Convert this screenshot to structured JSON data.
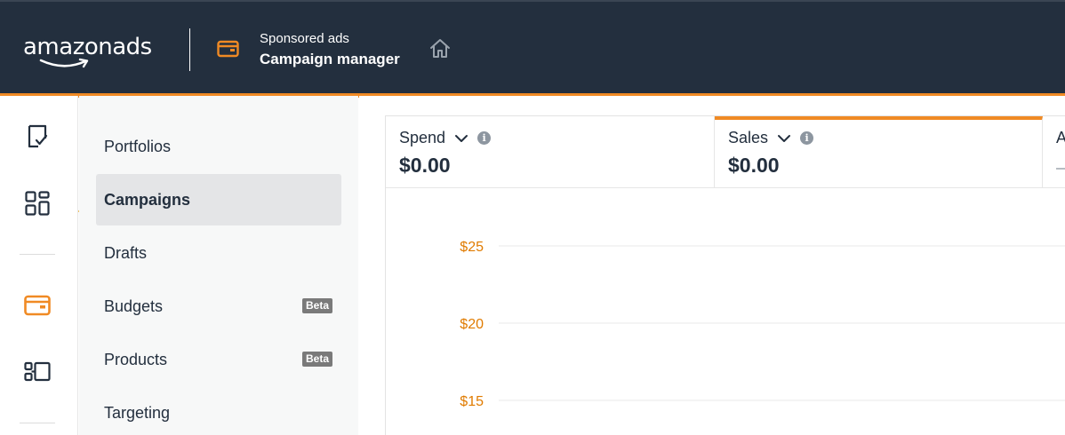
{
  "header": {
    "logo_text": "amazonads",
    "subtitle": "Sponsored ads",
    "title": "Campaign manager",
    "colors": {
      "background": "#232f3e",
      "accent": "#f08a24"
    }
  },
  "rail": {
    "items": [
      {
        "icon": "task-check-icon"
      },
      {
        "icon": "dashboard-grid-icon"
      },
      {
        "icon": "wallet-icon",
        "active": true
      },
      {
        "icon": "catalog-icon"
      }
    ]
  },
  "subnav": {
    "items": [
      {
        "label": "Portfolios"
      },
      {
        "label": "Campaigns",
        "active": true
      },
      {
        "label": "Drafts"
      },
      {
        "label": "Budgets",
        "badge": "Beta"
      },
      {
        "label": "Products",
        "badge": "Beta"
      },
      {
        "label": "Targeting"
      }
    ]
  },
  "metrics": [
    {
      "label": "Spend",
      "value": "$0.00"
    },
    {
      "label": "Sales",
      "value": "$0.00",
      "selected": true
    },
    {
      "label": "A",
      "value": ""
    }
  ],
  "chart_data": {
    "type": "line",
    "y_ticks": [
      "$25",
      "$20",
      "$15"
    ],
    "tick_values": [
      25,
      20,
      15
    ],
    "series": [],
    "grid": true,
    "tick_color": "#e07b00"
  }
}
